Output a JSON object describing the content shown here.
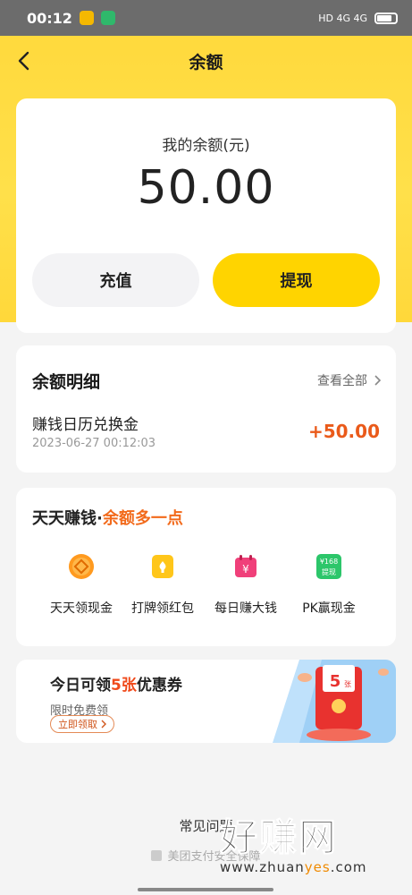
{
  "status_bar": {
    "time": "00:12",
    "right_text": "HD 4G 4G"
  },
  "nav": {
    "title": "余额"
  },
  "balance": {
    "label": "我的余额(元)",
    "value": "50.00",
    "recharge_label": "充值",
    "withdraw_label": "提现"
  },
  "details": {
    "title": "余额明细",
    "view_all": "查看全部",
    "items": [
      {
        "name": "赚钱日历兑换金",
        "time": "2023-06-27 00:12:03",
        "amount": "+50.00"
      }
    ]
  },
  "earn": {
    "title_main": "天天赚钱·",
    "title_highlight": "余额多一点",
    "items": [
      {
        "label": "天天领现金",
        "icon": "coin-icon"
      },
      {
        "label": "打牌领红包",
        "icon": "card-icon"
      },
      {
        "label": "每日赚大钱",
        "icon": "calendar-yuan-icon"
      },
      {
        "label": "PK赢现金",
        "icon": "cash-badge-icon",
        "badge_top": "¥168",
        "badge_bottom": "提现"
      }
    ]
  },
  "coupon": {
    "title_pre": "今日可领",
    "title_highlight": "5张",
    "title_post": "优惠券",
    "subtitle": "限时免费领",
    "button": "立即领取",
    "art_number": "5",
    "art_unit": "张"
  },
  "footer": {
    "faq": "常见问题",
    "security": "美团支付安全保障"
  },
  "watermark": {
    "big": "好赚网",
    "small_pre": "www.zhuan",
    "small_hi": "yes",
    "small_post": ".com"
  },
  "colors": {
    "brand_yellow": "#ffd400",
    "accent_orange": "#ea5a1a"
  }
}
